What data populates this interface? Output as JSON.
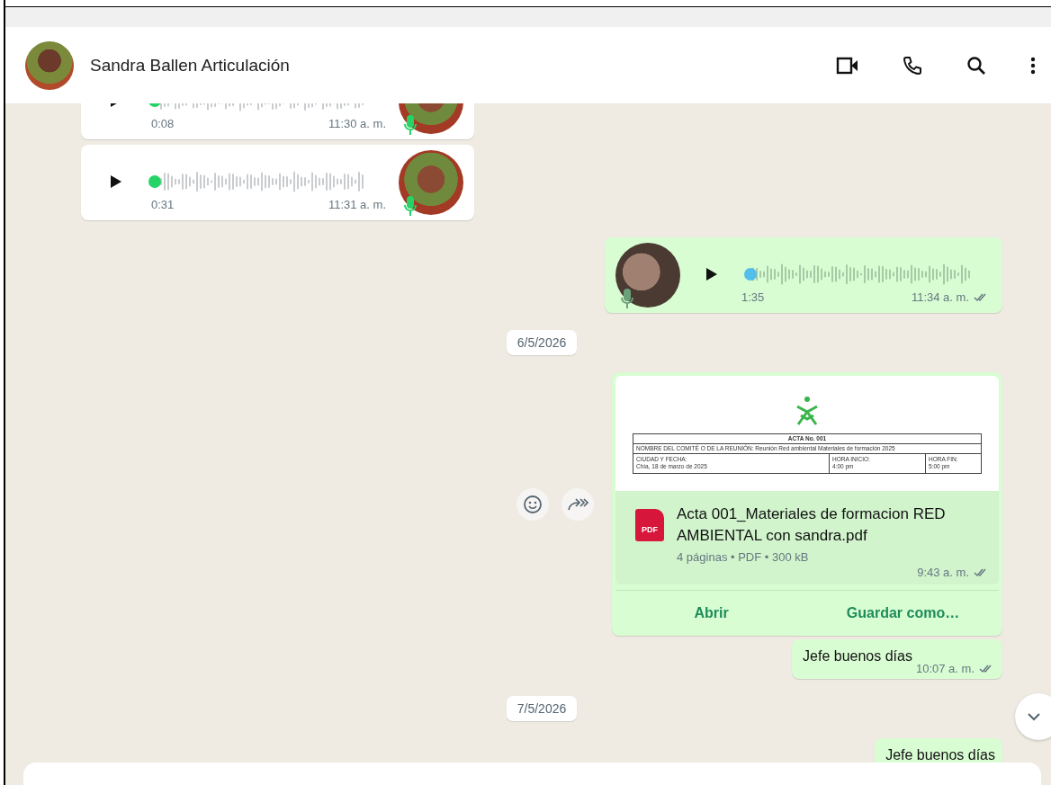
{
  "header": {
    "contact_name": "Sandra Ballen Articulación"
  },
  "messages": [
    {
      "kind": "voice",
      "outgoing": false,
      "duration": "0:08",
      "time": "11:30 a. m.",
      "color": "#25d366"
    },
    {
      "kind": "voice",
      "outgoing": false,
      "duration": "0:31",
      "time": "11:31 a. m.",
      "color": "#25d366"
    },
    {
      "kind": "voice",
      "outgoing": true,
      "duration": "1:35",
      "time": "11:34 a. m.",
      "color": "#53bdeb",
      "delivered": true
    },
    {
      "kind": "date",
      "text": "6/5/2026"
    },
    {
      "kind": "document",
      "outgoing": true,
      "preview": {
        "title": "ACTA No. 001",
        "subject": "NOMBRE DEL COMITÉ O DE LA REUNIÓN: Reunión Red ambiental Materiales de formación 2025",
        "cells": [
          {
            "label": "CIUDAD Y FECHA:",
            "value": "Chía, 18 de marzo de 2025"
          },
          {
            "label": "HORA INICIO:",
            "value": "4:00 pm"
          },
          {
            "label": "HORA FIN:",
            "value": "5:00 pm"
          }
        ]
      },
      "file_type_label": "PDF",
      "file_name": "Acta 001_Materiales de formacion RED AMBIENTAL con sandra.pdf",
      "meta": "4 páginas • PDF • 300 kB",
      "time": "9:43 a. m.",
      "delivered": true,
      "actions": [
        "Abrir",
        "Guardar como…"
      ]
    },
    {
      "kind": "text",
      "outgoing": true,
      "text": "Jefe buenos días",
      "time": "10:07 a. m.",
      "delivered": true
    },
    {
      "kind": "date",
      "text": "7/5/2026"
    },
    {
      "kind": "text",
      "outgoing": true,
      "text": "Jefe buenos días"
    }
  ]
}
